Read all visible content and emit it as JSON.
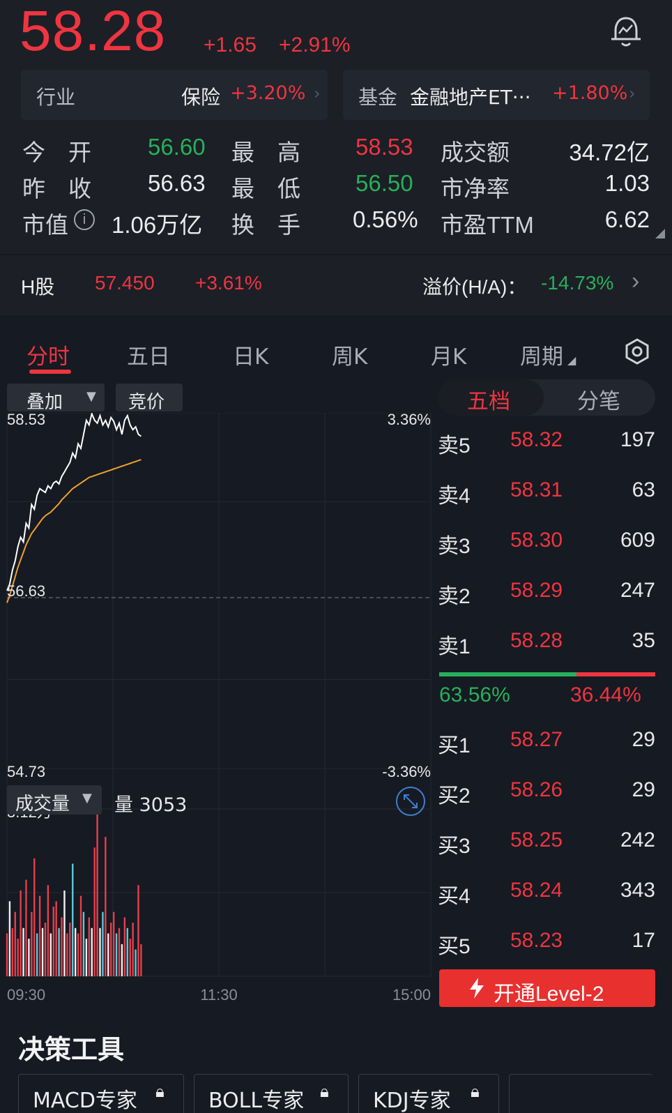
{
  "header": {
    "price": "58.28",
    "change": "+1.65",
    "change_pct": "+2.91%",
    "industry": {
      "label": "行业",
      "name": "保险",
      "pct": "+3.20%"
    },
    "fund": {
      "label": "基金",
      "name": "金融地产ET···",
      "pct": "+1.80%"
    }
  },
  "quote": {
    "open_label": "今　开",
    "open": "56.60",
    "high_label": "最　高",
    "high": "58.53",
    "amount_label": "成交额",
    "amount": "34.72亿",
    "prev_label": "昨　收",
    "prev": "56.63",
    "low_label": "最　低",
    "low": "56.50",
    "pb_label": "市净率",
    "pb": "1.03",
    "mcap_label": "市值",
    "mcap": "1.06万亿",
    "turnover_label": "换　手",
    "turnover": "0.56%",
    "pe_label": "市盈TTM",
    "pe": "6.62"
  },
  "hshare": {
    "label": "H股",
    "price": "57.450",
    "pct": "+3.61%",
    "premium_label": "溢价(H/A)：",
    "premium": "-14.73%"
  },
  "tabs": [
    "分时",
    "五日",
    "日K",
    "周K",
    "月K",
    "周期"
  ],
  "chart_toolbar": {
    "overlay": "叠加",
    "auction": "竞价",
    "volume_selector": "成交量",
    "volume_text": "量 3053"
  },
  "chart_data": {
    "type": "line",
    "title": "",
    "y_left_ticks": [
      "58.53",
      "56.63",
      "54.73"
    ],
    "y_right_ticks": [
      "3.36%",
      "-3.36%"
    ],
    "ylim": [
      54.73,
      58.53
    ],
    "prev_close": 56.63,
    "x_ticks": [
      "09:30",
      "11:30",
      "15:00"
    ],
    "total_minutes": 240,
    "series": [
      {
        "color": "#ffffff",
        "values": [
          56.63,
          56.7,
          56.85,
          56.95,
          57.1,
          57.2,
          57.15,
          57.35,
          57.3,
          57.55,
          57.5,
          57.65,
          57.72,
          57.7,
          57.68,
          57.75,
          57.72,
          57.78,
          57.8,
          57.77,
          57.85,
          57.9,
          57.95,
          58.0,
          58.1,
          58.05,
          58.2,
          58.15,
          58.3,
          58.45,
          58.4,
          58.52,
          58.45,
          58.42,
          58.5,
          58.4,
          58.45,
          58.38,
          58.48,
          58.44,
          58.35,
          58.42,
          58.3,
          58.45,
          58.5,
          58.4,
          58.35,
          58.38,
          58.3,
          58.28
        ]
      },
      {
        "color": "#f0a030",
        "values": [
          56.5,
          56.58,
          56.68,
          56.78,
          56.88,
          56.96,
          57.04,
          57.12,
          57.18,
          57.24,
          57.28,
          57.32,
          57.36,
          57.4,
          57.43,
          57.45,
          57.47,
          57.5,
          57.53,
          57.56,
          57.6,
          57.63,
          57.66,
          57.69,
          57.72,
          57.74,
          57.76,
          57.78,
          57.8,
          57.82,
          57.84,
          57.85,
          57.86,
          57.87,
          57.88,
          57.89,
          57.9,
          57.91,
          57.92,
          57.93,
          57.94,
          57.95,
          57.96,
          57.97,
          57.98,
          57.99,
          58.0,
          58.01,
          58.02,
          58.03
        ]
      }
    ],
    "volume": {
      "max_label": "3.12万",
      "max": 31200,
      "values": [
        8000,
        14000,
        9000,
        12000,
        7000,
        16000,
        9000,
        18000,
        7000,
        12000,
        22000,
        8000,
        15000,
        9000,
        10000,
        17000,
        8000,
        13000,
        14000,
        9000,
        11000,
        16000,
        8000,
        10000,
        21000,
        9000,
        8000,
        15000,
        12000,
        7000,
        11000,
        9000,
        24000,
        31200,
        9000,
        12000,
        26000,
        8000,
        10000,
        12000,
        8000,
        9000,
        6000,
        11000,
        9000,
        7000,
        10000,
        5000,
        17000,
        6000
      ],
      "colors": [
        "#e83e4c",
        "#f0f0f0",
        "#e83e4c",
        "#e83e4c",
        "#e83e4c",
        "#e83e4c",
        "#f0f0f0",
        "#e83e4c",
        "#f0f0f0",
        "#e83e4c",
        "#e83e4c",
        "#5ec8d8",
        "#e83e4c",
        "#f0f0f0",
        "#e83e4c",
        "#e83e4c",
        "#f0f0f0",
        "#e83e4c",
        "#e83e4c",
        "#5ec8d8",
        "#e83e4c",
        "#f0f0f0",
        "#e83e4c",
        "#e83e4c",
        "#5ec8d8",
        "#f0f0f0",
        "#e83e4c",
        "#e83e4c",
        "#5ec8d8",
        "#f0f0f0",
        "#e83e4c",
        "#f0f0f0",
        "#e83e4c",
        "#e83e4c",
        "#f0f0f0",
        "#5ec8d8",
        "#e83e4c",
        "#f0f0f0",
        "#e83e4c",
        "#e83e4c",
        "#5ec8d8",
        "#e83e4c",
        "#f0f0f0",
        "#e83e4c",
        "#5ec8d8",
        "#e83e4c",
        "#e83e4c",
        "#5ec8d8",
        "#e83e4c",
        "#e83e4c"
      ]
    }
  },
  "orderbook": {
    "tabs": [
      "五档",
      "分笔"
    ],
    "asks": [
      {
        "label": "卖5",
        "price": "58.32",
        "vol": "197"
      },
      {
        "label": "卖4",
        "price": "58.31",
        "vol": "63"
      },
      {
        "label": "卖3",
        "price": "58.30",
        "vol": "609"
      },
      {
        "label": "卖2",
        "price": "58.29",
        "vol": "247"
      },
      {
        "label": "卖1",
        "price": "58.28",
        "vol": "35"
      }
    ],
    "ratio": {
      "buy": "63.56%",
      "sell": "36.44%",
      "buy_fraction": 0.6356
    },
    "bids": [
      {
        "label": "买1",
        "price": "58.27",
        "vol": "29"
      },
      {
        "label": "买2",
        "price": "58.26",
        "vol": "29"
      },
      {
        "label": "买3",
        "price": "58.25",
        "vol": "242"
      },
      {
        "label": "买4",
        "price": "58.24",
        "vol": "343"
      },
      {
        "label": "买5",
        "price": "58.23",
        "vol": "17"
      }
    ],
    "level2_button": "开通Level-2"
  },
  "tools": {
    "title": "决策工具",
    "items": [
      "MACD专家",
      "BOLL专家",
      "KDJ专家"
    ]
  }
}
